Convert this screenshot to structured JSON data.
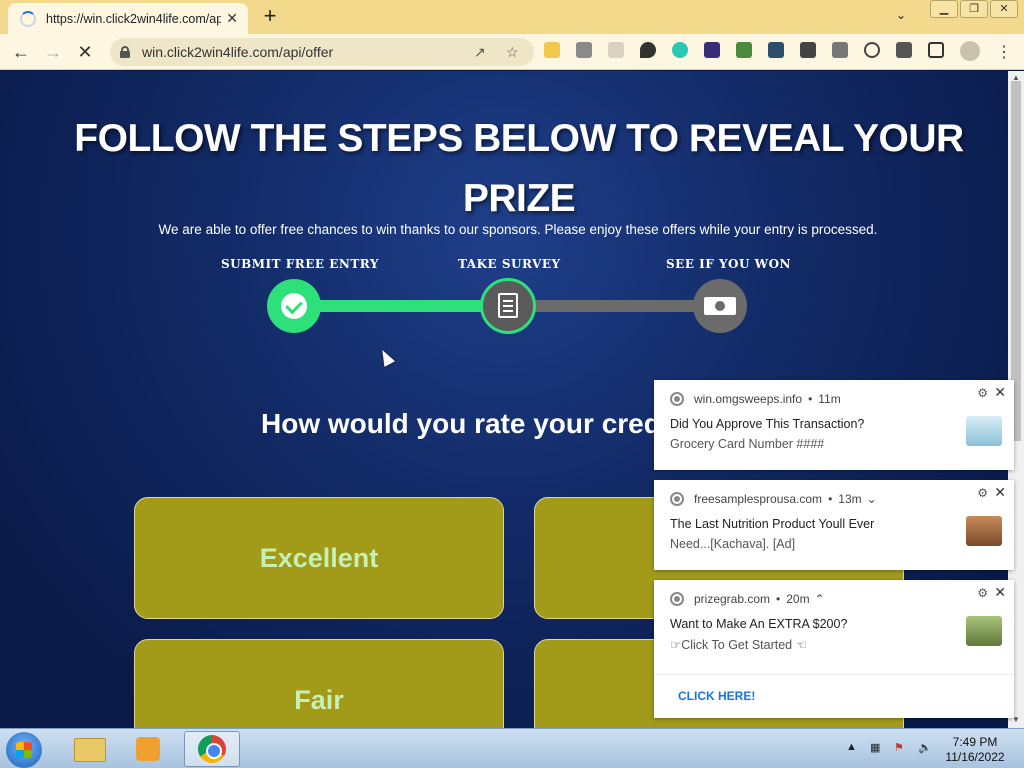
{
  "browser": {
    "tab_title": "https://win.click2win4life.com/ap",
    "new_tab": "+",
    "tab_close": "✕",
    "url": "win.click2win4life.com/api/offer",
    "window_buttons": [
      "▁",
      "❐",
      "✕"
    ]
  },
  "page": {
    "headline": "FOLLOW THE STEPS BELOW TO REVEAL YOUR PRIZE",
    "subline": "We are able to offer free chances to win thanks to our sponsors. Please enjoy these offers while your entry is processed.",
    "steps": [
      {
        "label": "SUBMIT FREE ENTRY",
        "state": "done"
      },
      {
        "label": "TAKE SURVEY",
        "state": "current"
      },
      {
        "label": "SEE IF YOU WON",
        "state": "pending"
      }
    ],
    "question": "How would you rate your cred",
    "options": [
      "Excellent",
      "",
      "Fair",
      ""
    ]
  },
  "notifications": [
    {
      "source": "win.omgsweeps.info",
      "time": "11m",
      "title": "Did You Approve This Transaction?",
      "body": "Grocery Card Number ####"
    },
    {
      "source": "freesamplesprousa.com",
      "time": "13m",
      "title": "The Last Nutrition Product Youll Ever",
      "body": "Need...[Kachava].    [Ad]"
    },
    {
      "source": "prizegrab.com",
      "time": "20m",
      "title": "Want to Make An EXTRA $200?",
      "body": "☞Click To Get Started ☜",
      "action": "CLICK HERE!"
    }
  ],
  "taskbar": {
    "time": "7:49 PM",
    "date": "11/16/2022"
  },
  "colors": {
    "progress_done": "#2ee07a",
    "progress_pending": "#6b6b6b",
    "option_bg": "#a29b1a",
    "option_text": "#c7f0b4",
    "page_bg": "#122a66",
    "tabbar_bg": "#f3d98c"
  }
}
